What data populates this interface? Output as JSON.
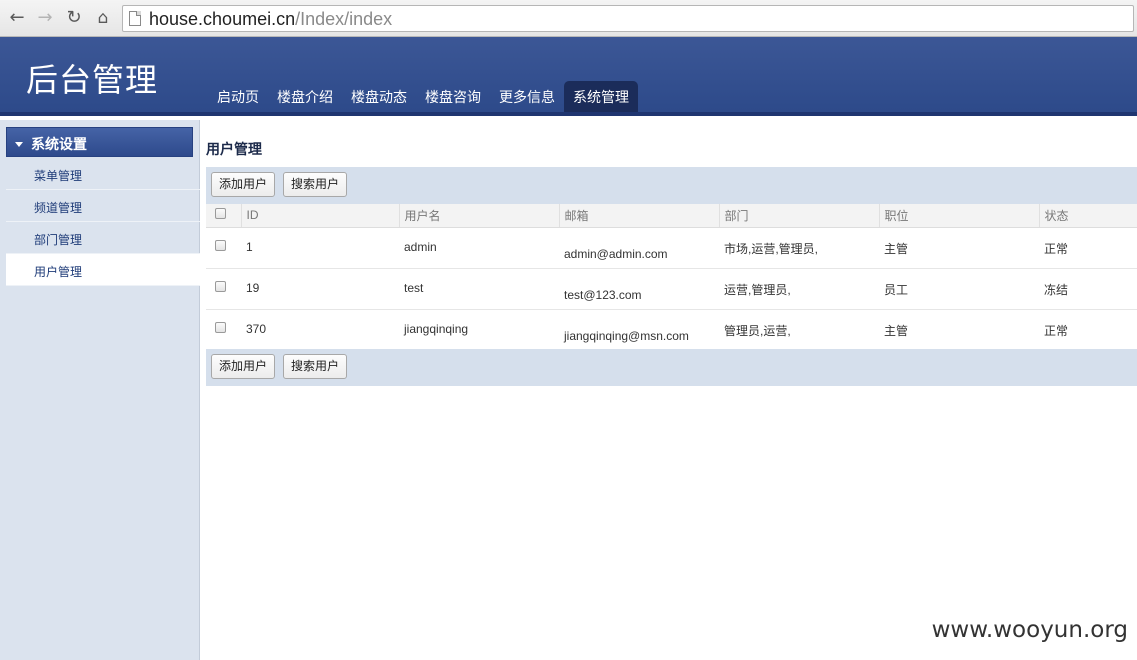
{
  "browser": {
    "url_host": "house.choumei.cn",
    "url_path": "/Index/index"
  },
  "header": {
    "title": "后台管理",
    "tabs": [
      {
        "label": "启动页"
      },
      {
        "label": "楼盘介绍"
      },
      {
        "label": "楼盘动态"
      },
      {
        "label": "楼盘咨询"
      },
      {
        "label": "更多信息"
      },
      {
        "label": "系统管理",
        "active": true
      }
    ]
  },
  "sidebar": {
    "section": "系统设置",
    "items": [
      {
        "label": "菜单管理"
      },
      {
        "label": "频道管理"
      },
      {
        "label": "部门管理"
      },
      {
        "label": "用户管理",
        "active": true
      }
    ]
  },
  "main": {
    "title": "用户管理",
    "add_label": "添加用户",
    "search_label": "搜索用户",
    "columns": [
      "ID",
      "用户名",
      "邮箱",
      "部门",
      "职位",
      "状态"
    ],
    "rows": [
      {
        "id": "1",
        "username": "admin",
        "email": "admin@admin.com",
        "dept": "市场,运营,管理员,",
        "position": "主管",
        "status": "正常",
        "status_color": "#108a10"
      },
      {
        "id": "19",
        "username": "test",
        "email": "test@123.com",
        "dept": "运营,管理员,",
        "position": "员工",
        "status": "冻结",
        "status_color": "#d01a1a"
      },
      {
        "id": "370",
        "username": "jiangqinqing",
        "email": "jiangqinqing@msn.com",
        "dept": "管理员,运营,",
        "position": "主管",
        "status": "正常",
        "status_color": "#108a10"
      }
    ]
  },
  "watermark": "www.wooyun.org"
}
